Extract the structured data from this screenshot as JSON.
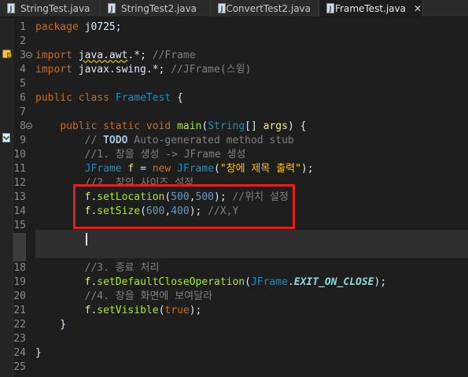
{
  "tabs": [
    {
      "label": "StringTest.java",
      "active": false
    },
    {
      "label": "StringTest2.java",
      "active": false
    },
    {
      "label": "ConvertTest2.java",
      "active": false
    },
    {
      "label": "*FrameTest.java",
      "active": true,
      "close": "✕"
    }
  ],
  "lines": [
    {
      "n": "1",
      "tokens": [
        [
          "kw",
          "package"
        ],
        [
          "pl",
          " j0725;"
        ]
      ]
    },
    {
      "n": "2",
      "tokens": []
    },
    {
      "n": "3",
      "tokens": [
        [
          "kw",
          "import"
        ],
        [
          "pl",
          " "
        ],
        [
          "ul",
          "java.awt"
        ],
        [
          "pl",
          ".*; "
        ],
        [
          "cm",
          "//Frame"
        ]
      ]
    },
    {
      "n": "4",
      "tokens": [
        [
          "kw",
          "import"
        ],
        [
          "pl",
          " javax.swing.*; "
        ],
        [
          "cm",
          "//JFrame(스윙)"
        ]
      ]
    },
    {
      "n": "5",
      "tokens": []
    },
    {
      "n": "6",
      "tokens": [
        [
          "kw",
          "public"
        ],
        [
          "pl",
          " "
        ],
        [
          "kw",
          "class"
        ],
        [
          "pl",
          " "
        ],
        [
          "type",
          "FrameTest"
        ],
        [
          "pl",
          " {"
        ]
      ]
    },
    {
      "n": "7",
      "tokens": []
    },
    {
      "n": "8",
      "tokens": [
        [
          "pl",
          "    "
        ],
        [
          "kw",
          "public"
        ],
        [
          "pl",
          " "
        ],
        [
          "kw",
          "static"
        ],
        [
          "pl",
          " "
        ],
        [
          "kw",
          "void"
        ],
        [
          "pl",
          " "
        ],
        [
          "fn",
          "main"
        ],
        [
          "pl",
          "("
        ],
        [
          "type",
          "String"
        ],
        [
          "pl",
          "[] "
        ],
        [
          "var",
          "args"
        ],
        [
          "pl",
          ") {"
        ]
      ]
    },
    {
      "n": "9",
      "tokens": [
        [
          "pl",
          "        "
        ],
        [
          "cm",
          "// "
        ],
        [
          "todo",
          "TODO"
        ],
        [
          "cm",
          " Auto-generated method stub"
        ]
      ]
    },
    {
      "n": "10",
      "tokens": [
        [
          "pl",
          "        "
        ],
        [
          "cm",
          "//1. 창을 생성 -> JFrame 생성"
        ]
      ]
    },
    {
      "n": "11",
      "tokens": [
        [
          "pl",
          "        "
        ],
        [
          "type",
          "JFrame"
        ],
        [
          "pl",
          " "
        ],
        [
          "var",
          "f"
        ],
        [
          "pl",
          " = "
        ],
        [
          "kw",
          "new"
        ],
        [
          "pl",
          " "
        ],
        [
          "type",
          "JFrame"
        ],
        [
          "pl",
          "("
        ],
        [
          "str",
          "\"창에 제목 출력\""
        ],
        [
          "pl",
          ");"
        ]
      ]
    },
    {
      "n": "12",
      "tokens": [
        [
          "pl",
          "        "
        ],
        [
          "cm",
          "//2. 창의 사이즈 설정"
        ]
      ]
    },
    {
      "n": "13",
      "tokens": [
        [
          "pl",
          "        "
        ],
        [
          "var",
          "f"
        ],
        [
          "pl",
          "."
        ],
        [
          "fn",
          "setLocation"
        ],
        [
          "pl",
          "("
        ],
        [
          "num",
          "500"
        ],
        [
          "pl",
          ","
        ],
        [
          "num",
          "500"
        ],
        [
          "pl",
          "); "
        ],
        [
          "cm",
          "//위치 설정"
        ]
      ]
    },
    {
      "n": "14",
      "tokens": [
        [
          "pl",
          "        "
        ],
        [
          "var",
          "f"
        ],
        [
          "pl",
          "."
        ],
        [
          "fn",
          "setSize"
        ],
        [
          "pl",
          "("
        ],
        [
          "num",
          "600"
        ],
        [
          "pl",
          ","
        ],
        [
          "num",
          "400"
        ],
        [
          "pl",
          "); "
        ],
        [
          "cm",
          "//X,Y"
        ]
      ]
    },
    {
      "n": "15",
      "tokens": []
    },
    {
      "n": "",
      "tokens": []
    },
    {
      "n": "",
      "tokens": []
    },
    {
      "n": "18",
      "tokens": [
        [
          "pl",
          "        "
        ],
        [
          "cm",
          "//3. 종료 처리"
        ]
      ]
    },
    {
      "n": "19",
      "tokens": [
        [
          "pl",
          "        "
        ],
        [
          "var",
          "f"
        ],
        [
          "pl",
          "."
        ],
        [
          "fn",
          "setDefaultCloseOperation"
        ],
        [
          "pl",
          "("
        ],
        [
          "type",
          "JFrame"
        ],
        [
          "pl",
          "."
        ],
        [
          "konst",
          "EXIT_ON_CLOSE"
        ],
        [
          "pl",
          ");"
        ]
      ]
    },
    {
      "n": "20",
      "tokens": [
        [
          "pl",
          "        "
        ],
        [
          "cm",
          "//4. 창을 화면에 보여달라"
        ]
      ]
    },
    {
      "n": "21",
      "tokens": [
        [
          "pl",
          "        "
        ],
        [
          "var",
          "f"
        ],
        [
          "pl",
          "."
        ],
        [
          "fn",
          "setVisible"
        ],
        [
          "pl",
          "("
        ],
        [
          "kw",
          "true"
        ],
        [
          "pl",
          ");"
        ]
      ]
    },
    {
      "n": "22",
      "tokens": [
        [
          "pl",
          "    }"
        ]
      ]
    },
    {
      "n": "23",
      "tokens": []
    },
    {
      "n": "24",
      "tokens": [
        [
          "pl",
          "}"
        ]
      ]
    },
    {
      "n": "25",
      "tokens": []
    }
  ],
  "folds": [
    "3",
    "8"
  ],
  "colors": {
    "editor_bg": "#1e1e1e",
    "keyword": "#cc6c1d",
    "comment": "#808080",
    "string": "#ffc600",
    "highlight_box": "#e02020"
  },
  "markers": {
    "line3": "warning-icon",
    "line9": "task-icon"
  }
}
